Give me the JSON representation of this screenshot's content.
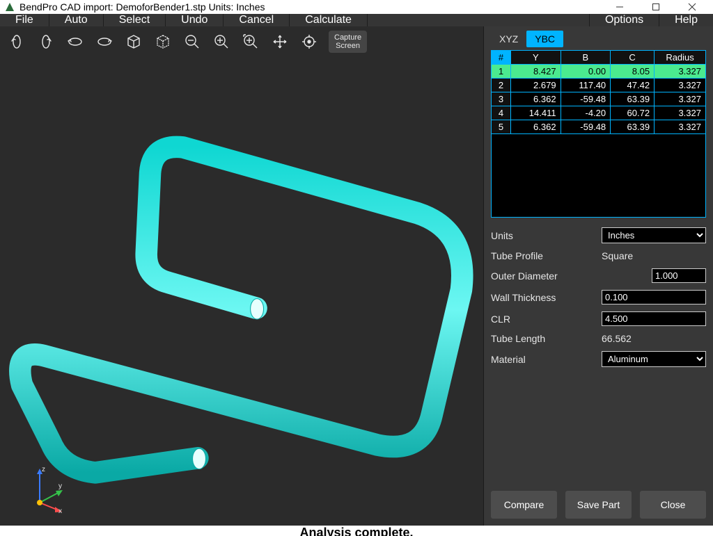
{
  "title": "BendPro CAD import: DemoforBender1.stp  Units: Inches",
  "menu": {
    "file": "File",
    "auto": "Auto",
    "select": "Select",
    "undo": "Undo",
    "cancel": "Cancel",
    "calculate": "Calculate",
    "options": "Options",
    "help": "Help"
  },
  "toolbar": {
    "capture": "Capture\nScreen"
  },
  "tabs": {
    "xyz": "XYZ",
    "ybc": "YBC"
  },
  "bendtable": {
    "headers": {
      "num": "#",
      "y": "Y",
      "b": "B",
      "c": "C",
      "r": "Radius"
    },
    "rows": [
      {
        "n": "1",
        "y": "8.427",
        "b": "0.00",
        "c": "8.05",
        "r": "3.327",
        "hl": true
      },
      {
        "n": "2",
        "y": "2.679",
        "b": "117.40",
        "c": "47.42",
        "r": "3.327"
      },
      {
        "n": "3",
        "y": "6.362",
        "b": "-59.48",
        "c": "63.39",
        "r": "3.327"
      },
      {
        "n": "4",
        "y": "14.411",
        "b": "-4.20",
        "c": "60.72",
        "r": "3.327"
      },
      {
        "n": "5",
        "y": "6.362",
        "b": "-59.48",
        "c": "63.39",
        "r": "3.327"
      }
    ]
  },
  "props": {
    "units_label": "Units",
    "units_value": "Inches",
    "profile_label": "Tube Profile",
    "profile_value": "Square",
    "od_label": "Outer Diameter",
    "od_value": "1.000",
    "wt_label": "Wall Thickness",
    "wt_value": "0.100",
    "clr_label": "CLR",
    "clr_value": "4.500",
    "len_label": "Tube Length",
    "len_value": "66.562",
    "mat_label": "Material",
    "mat_value": "Aluminum"
  },
  "footer": {
    "compare": "Compare",
    "save": "Save Part",
    "close": "Close"
  },
  "status": "Analysis complete.",
  "axis": {
    "x": "x",
    "y": "y",
    "z": "z"
  }
}
